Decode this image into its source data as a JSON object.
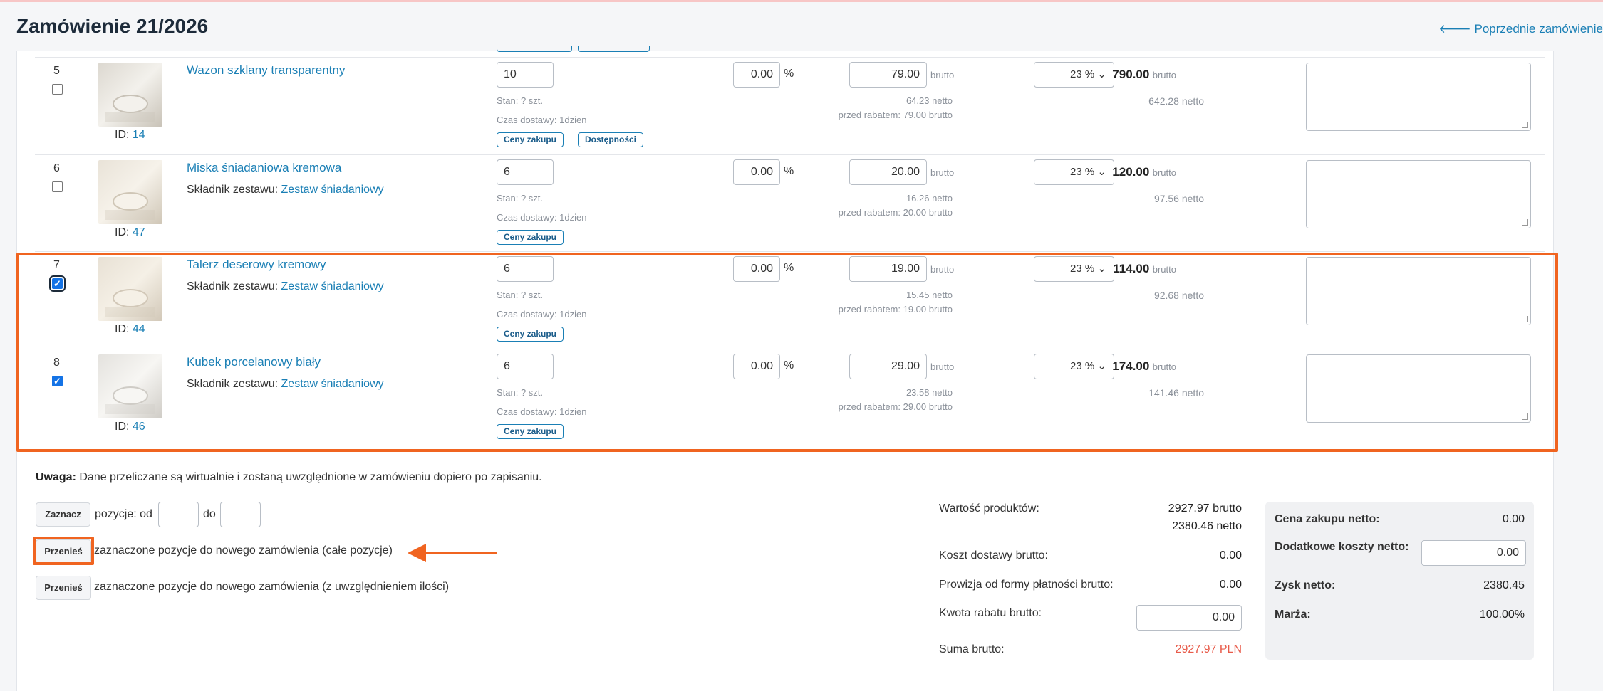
{
  "header": {
    "title": "Zamówienie 21/2026",
    "prev_link": "Poprzednie zamówienie"
  },
  "rows": [
    {
      "num": "5",
      "checked": false,
      "id_label": "ID:",
      "id": "14",
      "name": "Wazon szklany transparentny",
      "kit_label": "",
      "kit": "",
      "qty": "10",
      "stock": "Stan: ? szt.",
      "delivery": "Czas dostawy: 1dzien",
      "buttons": [
        "Ceny zakupu",
        "Dostępności"
      ],
      "discount": "0.00",
      "pct": "%",
      "price": "79.00",
      "brutto": "brutto",
      "netto": "64.23 netto",
      "before": "przed rabatem: 79.00 brutto",
      "vat": "23 %",
      "total": "790.00",
      "total_netto": "642.28 netto"
    },
    {
      "num": "6",
      "checked": false,
      "id_label": "ID:",
      "id": "47",
      "name": "Miska śniadaniowa kremowa",
      "kit_label": "Składnik zestawu:",
      "kit": "Zestaw śniadaniowy",
      "qty": "6",
      "stock": "Stan: ? szt.",
      "delivery": "Czas dostawy: 1dzien",
      "buttons": [
        "Ceny zakupu"
      ],
      "discount": "0.00",
      "pct": "%",
      "price": "20.00",
      "brutto": "brutto",
      "netto": "16.26 netto",
      "before": "przed rabatem: 20.00 brutto",
      "vat": "23 %",
      "total": "120.00",
      "total_netto": "97.56 netto"
    },
    {
      "num": "7",
      "checked": true,
      "id_label": "ID:",
      "id": "44",
      "name": "Talerz deserowy kremowy",
      "kit_label": "Składnik zestawu:",
      "kit": "Zestaw śniadaniowy",
      "qty": "6",
      "stock": "Stan: ? szt.",
      "delivery": "Czas dostawy: 1dzien",
      "buttons": [
        "Ceny zakupu"
      ],
      "discount": "0.00",
      "pct": "%",
      "price": "19.00",
      "brutto": "brutto",
      "netto": "15.45 netto",
      "before": "przed rabatem: 19.00 brutto",
      "vat": "23 %",
      "total": "114.00",
      "total_netto": "92.68 netto"
    },
    {
      "num": "8",
      "checked": true,
      "id_label": "ID:",
      "id": "46",
      "name": "Kubek porcelanowy biały",
      "kit_label": "Składnik zestawu:",
      "kit": "Zestaw śniadaniowy",
      "qty": "6",
      "stock": "Stan: ? szt.",
      "delivery": "Czas dostawy: 1dzien",
      "buttons": [
        "Ceny zakupu"
      ],
      "discount": "0.00",
      "pct": "%",
      "price": "29.00",
      "brutto": "brutto",
      "netto": "23.58 netto",
      "before": "przed rabatem: 29.00 brutto",
      "vat": "23 %",
      "total": "174.00",
      "total_netto": "141.46 netto"
    }
  ],
  "warning": {
    "bold": "Uwaga:",
    "text": "Dane przeliczane są wirtualnie i zostaną uwzględnione w zamówieniu dopiero po zapisaniu."
  },
  "select_range": {
    "button": "Zaznacz",
    "label_from": "pozycje: od",
    "label_to": "do"
  },
  "move_all": {
    "button": "Przenieś",
    "text": "zaznaczone pozycje do nowego zamówienia (całe pozycje)"
  },
  "move_qty": {
    "button": "Przenieś",
    "text": "zaznaczone pozycje do nowego zamówienia (z uwzględnieniem ilości)"
  },
  "summary": {
    "products_label": "Wartość produktów:",
    "products_brutto": "2927.97 brutto",
    "products_netto": "2380.46 netto",
    "shipping_label": "Koszt dostawy brutto:",
    "shipping": "0.00",
    "commission_label": "Prowizja od formy płatności brutto:",
    "commission": "0.00",
    "discount_label": "Kwota rabatu brutto:",
    "discount": "0.00",
    "total_label": "Suma brutto:",
    "total": "2927.97 PLN"
  },
  "side": {
    "purchase_label": "Cena zakupu netto:",
    "purchase": "0.00",
    "extra_label": "Dodatkowe koszty netto:",
    "extra": "0.00",
    "profit_label": "Zysk netto:",
    "profit": "2380.45",
    "margin_label": "Marża:",
    "margin": "100.00%"
  },
  "colors": {
    "accent": "#1a7fb5",
    "highlight": "#f06420",
    "total_red": "#e85b4a"
  }
}
